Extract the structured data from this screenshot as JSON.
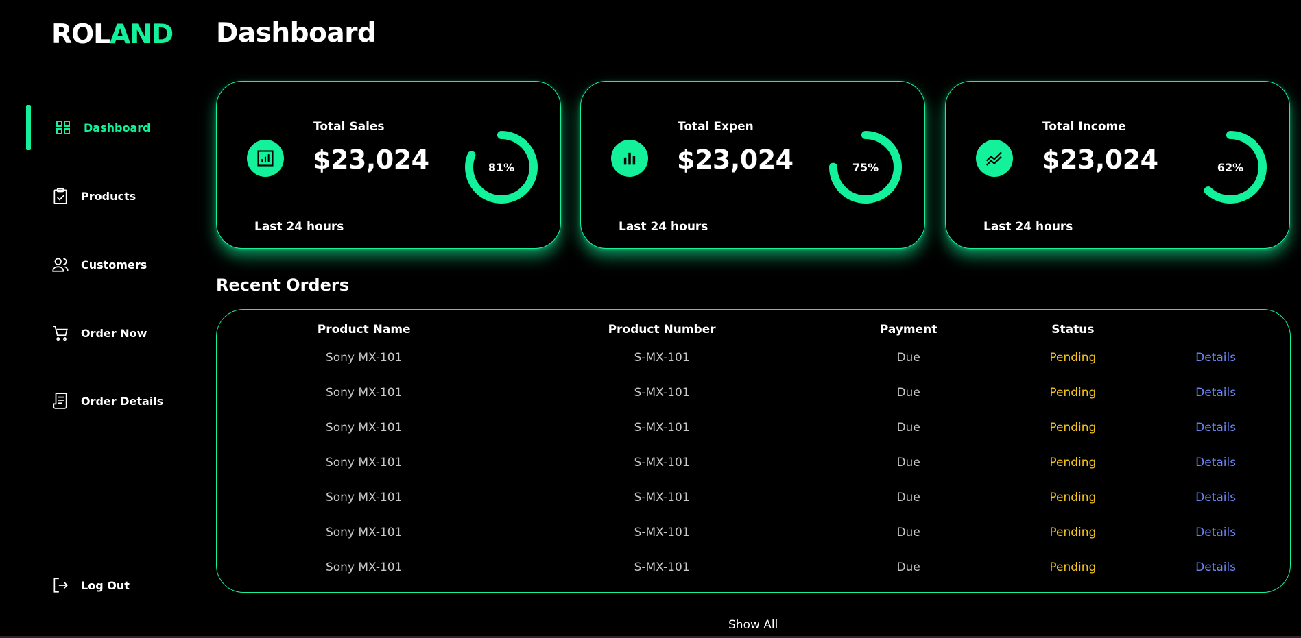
{
  "brand": {
    "part1": "ROL",
    "part2": "AND"
  },
  "colors": {
    "accent": "#13f29a",
    "background": "#000000",
    "pending": "#f6c51a",
    "link": "#6a86f7"
  },
  "sidebar": {
    "items": [
      {
        "label": "Dashboard",
        "icon": "grid-icon",
        "active": true
      },
      {
        "label": "Products",
        "icon": "clipboard-check-icon"
      },
      {
        "label": "Customers",
        "icon": "users-icon"
      },
      {
        "label": "Order Now",
        "icon": "cart-icon"
      },
      {
        "label": "Order Details",
        "icon": "receipt-icon"
      }
    ],
    "logout": {
      "label": "Log Out",
      "icon": "logout-icon"
    }
  },
  "header": {
    "title": "Dashboard"
  },
  "cards": [
    {
      "title": "Total Sales",
      "value": "$23,024",
      "percent_label": "81%",
      "percent": 81,
      "footer": "Last 24 hours",
      "icon": "chart-report-icon"
    },
    {
      "title": "Total Expen",
      "value": "$23,024",
      "percent_label": "75%",
      "percent": 75,
      "footer": "Last 24 hours",
      "icon": "bar-chart-icon"
    },
    {
      "title": "Total Income",
      "value": "$23,024",
      "percent_label": "62%",
      "percent": 62,
      "footer": "Last 24 hours",
      "icon": "trend-icon"
    }
  ],
  "orders": {
    "title": "Recent Orders",
    "columns": [
      "Product Name",
      "Product Number",
      "Payment",
      "Status",
      ""
    ],
    "rows": [
      {
        "name": "Sony MX-101",
        "number": "S-MX-101",
        "payment": "Due",
        "status": "Pending",
        "action": "Details"
      },
      {
        "name": "Sony MX-101",
        "number": "S-MX-101",
        "payment": "Due",
        "status": "Pending",
        "action": "Details"
      },
      {
        "name": "Sony MX-101",
        "number": "S-MX-101",
        "payment": "Due",
        "status": "Pending",
        "action": "Details"
      },
      {
        "name": "Sony MX-101",
        "number": "S-MX-101",
        "payment": "Due",
        "status": "Pending",
        "action": "Details"
      },
      {
        "name": "Sony MX-101",
        "number": "S-MX-101",
        "payment": "Due",
        "status": "Pending",
        "action": "Details"
      },
      {
        "name": "Sony MX-101",
        "number": "S-MX-101",
        "payment": "Due",
        "status": "Pending",
        "action": "Details"
      },
      {
        "name": "Sony MX-101",
        "number": "S-MX-101",
        "payment": "Due",
        "status": "Pending",
        "action": "Details"
      }
    ],
    "show_all": "Show All"
  }
}
